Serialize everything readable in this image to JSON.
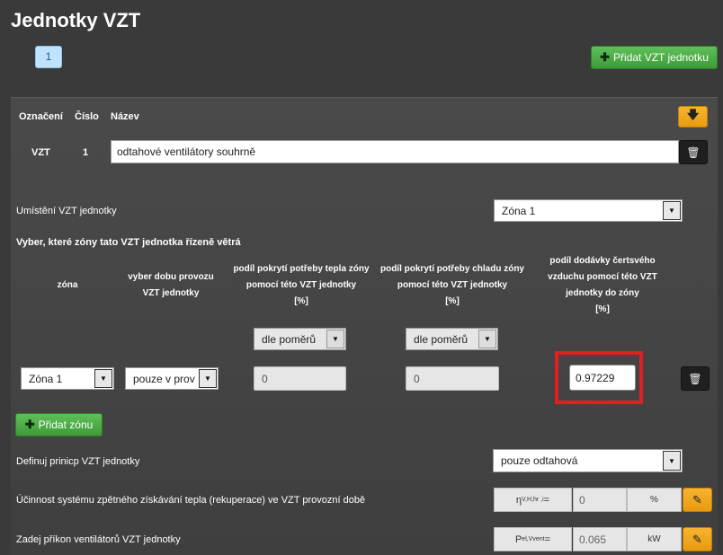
{
  "page_title": "Jednotky VZT",
  "pagination": {
    "current": "1"
  },
  "add_unit_label": "Přidat VZT jednotku",
  "unit": {
    "headers": {
      "oznaceni": "Označení",
      "cislo": "Číslo",
      "nazev": "Název"
    },
    "oznaceni": "VZT",
    "cislo": "1",
    "nazev": "odtahové ventilátory souhrně"
  },
  "placement": {
    "label": "Umístění VZT jednotky",
    "value": "Zóna 1"
  },
  "zones_heading": "Vyber, které zóny tato VZT jednotka řízeně větrá",
  "columns": {
    "zona": "zóna",
    "doba": [
      "vyber dobu provozu",
      "VZT jednotky"
    ],
    "teplo": [
      "podíl pokrytí potřeby tepla zóny",
      "pomocí této VZT jednotky",
      "[%]"
    ],
    "chlad": [
      "podíl pokrytí potřeby chladu zóny",
      "pomocí této VZT jednotky",
      "[%]"
    ],
    "dodavka": [
      "podíl dodávky čertsvého",
      "vzduchu pomocí této VZT",
      "jednotky do zóny",
      "[%]"
    ]
  },
  "ratio_teplo": "dle poměrů",
  "ratio_chlad": "dle poměrů",
  "zone_row": {
    "zona": "Zóna 1",
    "doba": "pouze v prov",
    "teplo": "0",
    "chlad": "0",
    "dodavka": "0.97229"
  },
  "add_zone_label": "Přidat zónu",
  "principle": {
    "label": "Definuj prinicp VZT jednotky",
    "value": "pouze odtahová"
  },
  "efficiency": {
    "label": "Účinnost systému zpětného získávání tepla (rekuperace) ve VZT provozní době",
    "symbol": "η",
    "symbol_sub": "V,H,hr ,i",
    "symbol_suffix": " =",
    "value": "0",
    "unit": "%"
  },
  "fan_power": {
    "label": "Zadej příkon ventilátorů VZT jednotky",
    "symbol": "P",
    "symbol_sub": "el,Vvent",
    "symbol_suffix": "=",
    "value": "0.065",
    "unit": "kW"
  },
  "colors": {
    "green": "#4cae45",
    "orange": "#f0a820",
    "highlight": "#e02020"
  }
}
